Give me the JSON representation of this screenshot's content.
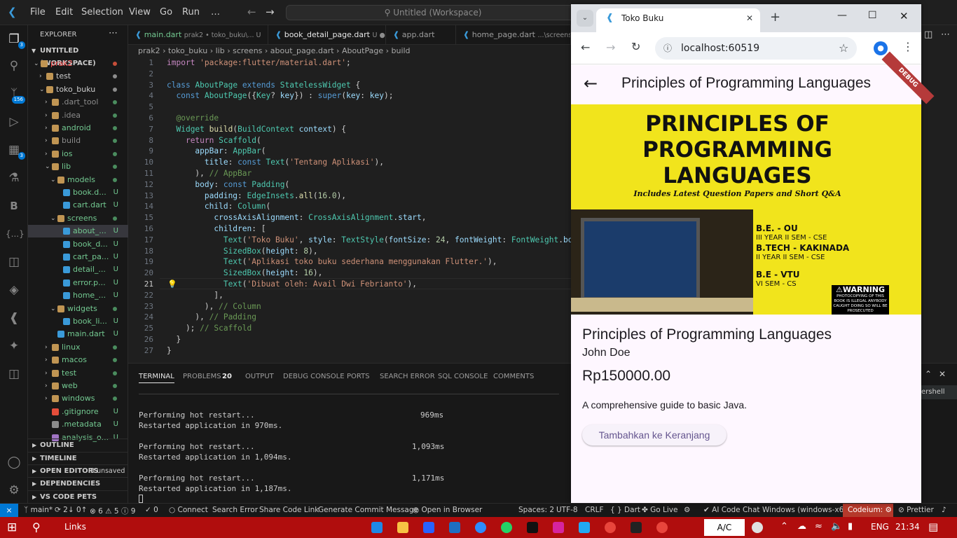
{
  "titlebar": {
    "menu": [
      "File",
      "Edit",
      "Selection",
      "View",
      "Go",
      "Run",
      "…"
    ],
    "command_center": "Untitled (Workspace)"
  },
  "activity": {
    "explorer_badge": "3",
    "scm_badge": "156",
    "extensions_badge": "3"
  },
  "sidebar": {
    "title": "EXPLORER",
    "workspace": "UNTITLED (WORKSPACE)",
    "tree": [
      {
        "label": "prak2",
        "status": "",
        "color": "#f14c4c"
      },
      {
        "label": "test",
        "status": "",
        "color": "#cccccc"
      },
      {
        "label": "toko_buku",
        "status": "",
        "color": "#cccccc"
      },
      {
        "label": ".dart_tool",
        "status": "",
        "color": "#8c8c8c"
      },
      {
        "label": ".idea",
        "status": "",
        "color": "#8c8c8c"
      },
      {
        "label": "android",
        "status": "",
        "color": "#73c991"
      },
      {
        "label": "build",
        "status": "",
        "color": "#8c8c8c"
      },
      {
        "label": "ios",
        "status": "",
        "color": "#73c991"
      },
      {
        "label": "lib",
        "status": "",
        "color": "#73c991"
      },
      {
        "label": "models",
        "status": "",
        "color": "#73c991"
      },
      {
        "label": "book.d...",
        "status": "U",
        "color": "#73c991"
      },
      {
        "label": "cart.dart",
        "status": "U",
        "color": "#73c991"
      },
      {
        "label": "screens",
        "status": "",
        "color": "#73c991"
      },
      {
        "label": "about_...",
        "status": "U",
        "color": "#73c991"
      },
      {
        "label": "book_d...",
        "status": "U",
        "color": "#73c991"
      },
      {
        "label": "cart_pa...",
        "status": "U",
        "color": "#73c991"
      },
      {
        "label": "detail_...",
        "status": "U",
        "color": "#73c991"
      },
      {
        "label": "error.p...",
        "status": "U",
        "color": "#73c991"
      },
      {
        "label": "home_...",
        "status": "U",
        "color": "#73c991"
      },
      {
        "label": "widgets",
        "status": "",
        "color": "#73c991"
      },
      {
        "label": "book_li...",
        "status": "U",
        "color": "#73c991"
      },
      {
        "label": "main.dart",
        "status": "U",
        "color": "#73c991"
      },
      {
        "label": "linux",
        "status": "",
        "color": "#73c991"
      },
      {
        "label": "macos",
        "status": "",
        "color": "#73c991"
      },
      {
        "label": "test",
        "status": "",
        "color": "#73c991"
      },
      {
        "label": "web",
        "status": "",
        "color": "#73c991"
      },
      {
        "label": "windows",
        "status": "",
        "color": "#73c991"
      },
      {
        "label": ".gitignore",
        "status": "U",
        "color": "#73c991"
      },
      {
        "label": ".metadata",
        "status": "U",
        "color": "#73c991"
      },
      {
        "label": "analysis_o...",
        "status": "U",
        "color": "#73c991"
      }
    ],
    "sections": {
      "outline": "OUTLINE",
      "timeline": "TIMELINE",
      "open_editors": "OPEN EDITORS",
      "unsaved": "3 unsaved",
      "dependencies": "DEPENDENCIES",
      "vs_code_pets": "VS CODE PETS"
    }
  },
  "tabs": [
    {
      "label": "main.dart",
      "hint": "prak2 • toko_buku\\... U"
    },
    {
      "label": "book_detail_page.dart",
      "hint": "U ●"
    },
    {
      "label": "app.dart",
      "hint": ""
    },
    {
      "label": "home_page.dart",
      "hint": "...\\screens U"
    }
  ],
  "breadcrumbs": "prak2 › toko_buku › lib › screens › about_page.dart › AboutPage › build",
  "editor": {
    "active_line": 21
  },
  "panel": {
    "tabs": [
      "TERMINAL",
      "PROBLEMS",
      "OUTPUT",
      "DEBUG CONSOLE",
      "PORTS",
      "SEARCH ERROR",
      "SQL CONSOLE",
      "COMMENTS"
    ],
    "problems_count": "20",
    "terminal": [
      {
        "l1": "Performing hot restart...",
        "t": "969ms",
        "l2": "Restarted application in 970ms."
      },
      {
        "l1": "Performing hot restart...",
        "t": "1,093ms",
        "l2": "Restarted application in 1,094ms."
      },
      {
        "l1": "Performing hot restart...",
        "t": "1,171ms",
        "l2": "Restarted application in 1,187ms."
      }
    ],
    "side_label": "ershell"
  },
  "statusbar": {
    "branch": "main*",
    "sync": "2↓ 0↑",
    "errors": "6",
    "warnings": "5",
    "info": "9",
    "ports": "0",
    "connect": "Connect",
    "search_error": "Search Error",
    "share": "Share Code Link",
    "commit": "Generate Commit Message",
    "open_browser": "Open in Browser",
    "spaces": "Spaces: 2",
    "encoding": "UTF-8",
    "eol": "CRLF",
    "lang": "Dart",
    "golive": "Go Live",
    "aicode": "AI Code Chat",
    "device": "Windows (windows-x64)",
    "codeium": "Codeium:",
    "prettier": "Prettier"
  },
  "browser": {
    "tab_title": "Toko Buku",
    "url": "localhost:60519",
    "debug_banner": "DEBUG",
    "app": {
      "appbar_title": "Principles of Programming Languages",
      "cover": {
        "l1": "PRINCIPLES OF",
        "l2": "PROGRAMMING",
        "l3": "LANGUAGES",
        "sub": "Includes Latest Question Papers and Short Q&A",
        "b1": "B.E. - OU",
        "b1s": "III YEAR II SEM - CSE",
        "b2": "B.TECH - KAKINADA",
        "b2s": "II YEAR II SEM - CSE",
        "b3": "B.E - VTU",
        "b3s": "VI SEM - CS",
        "warn": "WARNING",
        "warn_sub": "PHOTOCOPYING OF THIS BOOK IS ILLEGAL ANYBODY CAUGHT DOING SO WILL BE PROSECUTED"
      },
      "book_title": "Principles of Programming Languages",
      "author": "John Doe",
      "price": "Rp150000.00",
      "description": "A comprehensive guide to basic Java.",
      "button": "Tambahkan ke Keranjang"
    }
  },
  "taskbar": {
    "search": "Links",
    "ac": "A/C",
    "lang": "ENG",
    "time": "21:34"
  },
  "colors": {
    "accent": "#0078d4",
    "taskbar": "#b00d0d",
    "flutter_bg": "#fef7ff",
    "cover_yellow": "#f1e41c"
  }
}
